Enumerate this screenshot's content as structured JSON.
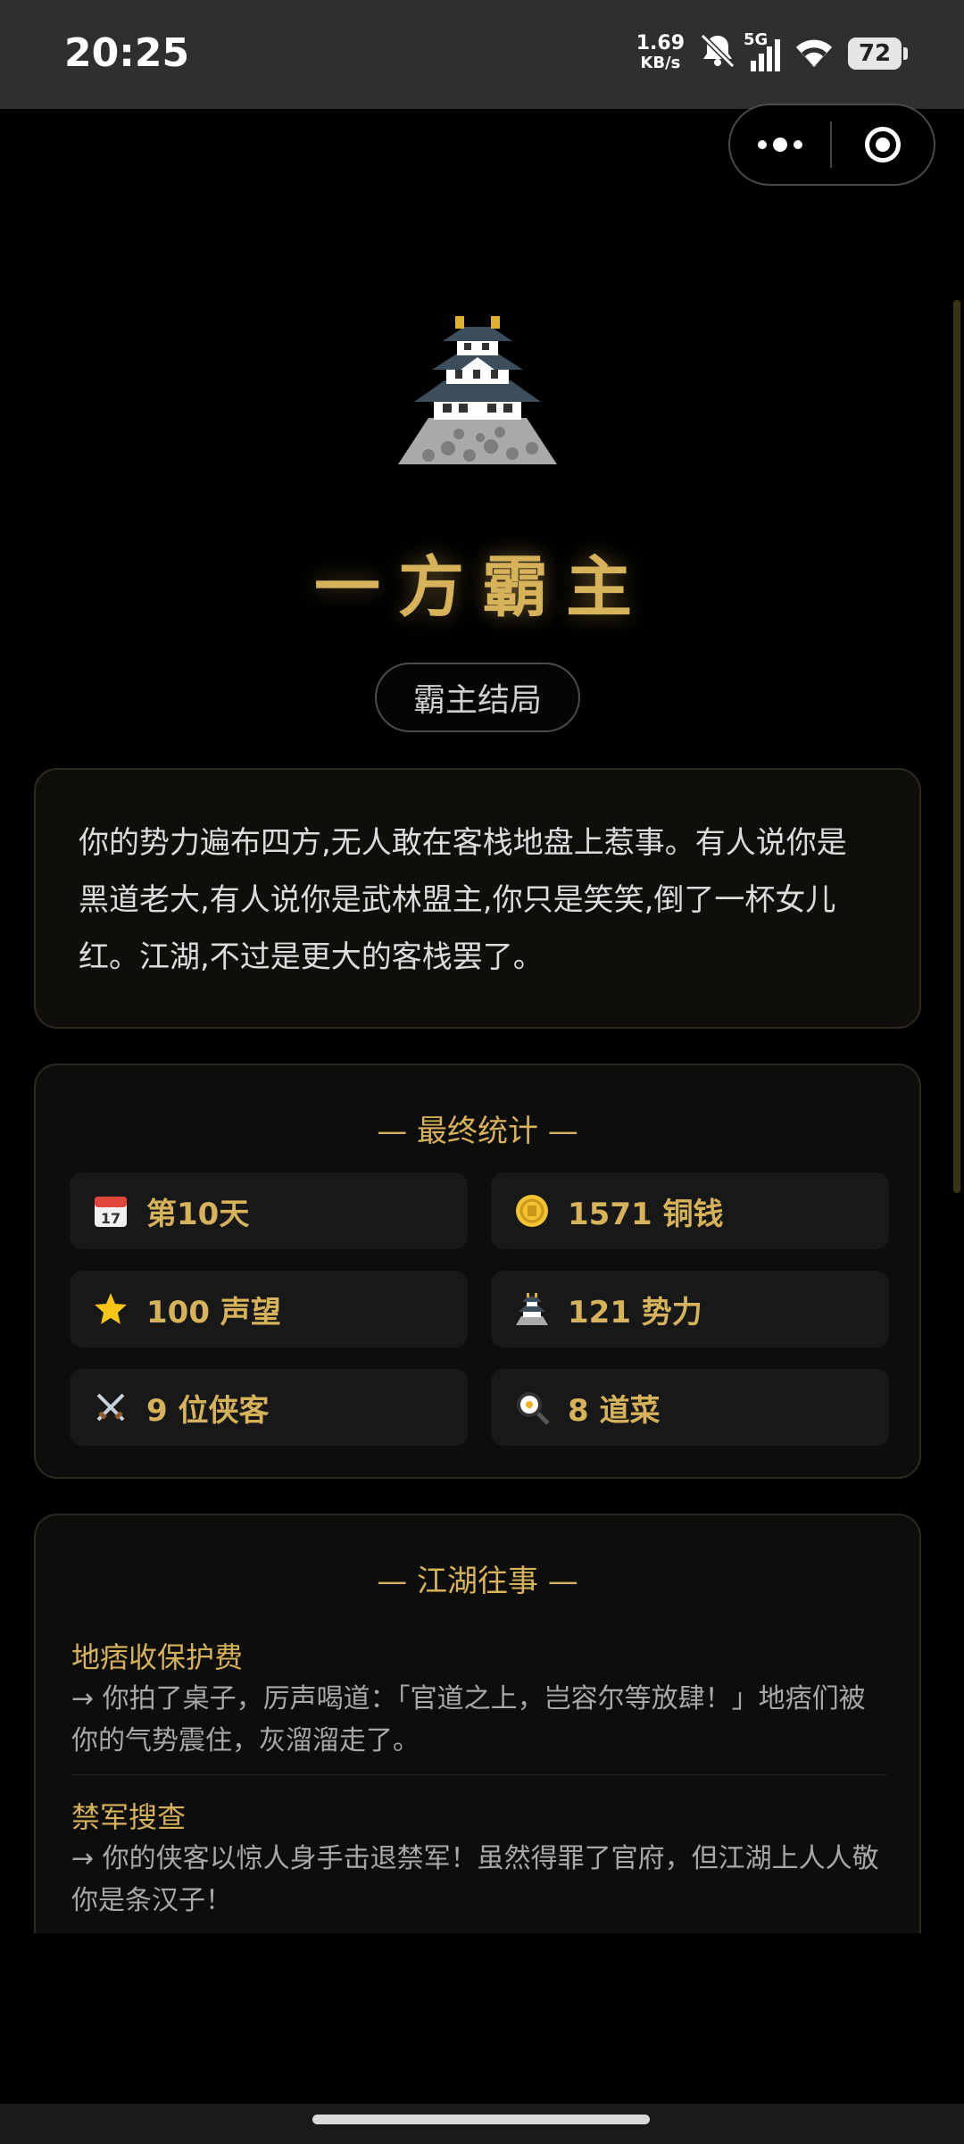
{
  "status_bar": {
    "time": "20:25",
    "net_speed_value": "1.69",
    "net_speed_unit": "KB/s",
    "network": "5G",
    "battery": "72"
  },
  "ending": {
    "title": "一方霸主",
    "badge": "霸主结局",
    "description": "你的势力遍布四方,无人敢在客栈地盘上惹事。有人说你是黑道老大,有人说你是武林盟主,你只是笑笑,倒了一杯女儿红。江湖,不过是更大的客栈罢了。"
  },
  "stats": {
    "section_title": "— 最终统计 —",
    "items": [
      {
        "icon": "calendar-icon",
        "label": "第10天"
      },
      {
        "icon": "coin-icon",
        "label": "1571 铜钱"
      },
      {
        "icon": "star-icon",
        "label": "100 声望"
      },
      {
        "icon": "castle-icon",
        "label": "121 势力"
      },
      {
        "icon": "crossed-swords-icon",
        "label": "9 位侠客"
      },
      {
        "icon": "frying-pan-icon",
        "label": "8 道菜"
      }
    ]
  },
  "events": {
    "section_title": "— 江湖往事 —",
    "items": [
      {
        "title": "地痞收保护费",
        "result": "→ 你拍了桌子，厉声喝道：「官道之上，岂容尔等放肆！」地痞们被你的气势震住，灰溜溜走了。"
      },
      {
        "title": "禁军搜查",
        "result": "→ 你的侠客以惊人身手击退禁军！虽然得罪了官府，但江湖上人人敬你是条汉子！"
      }
    ]
  },
  "colors": {
    "accent_gold": "#d6b25a",
    "background": "#000000",
    "card": "#0d0d0c"
  }
}
